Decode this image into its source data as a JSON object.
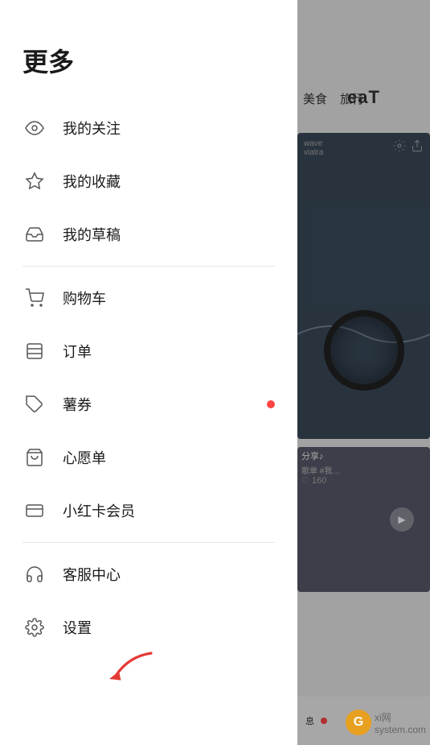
{
  "page": {
    "title": "更多",
    "background": {
      "tabs": [
        "美食",
        "旅行"
      ],
      "eat_text": "eaT",
      "card2_text": "分享♪",
      "card2_subtext": "歌单 #我…",
      "heart_count": "160",
      "bottom_label": "息"
    }
  },
  "menu": {
    "title": "更多",
    "items": [
      {
        "id": "my-follow",
        "label": "我的关注",
        "icon": "eye",
        "badge": false
      },
      {
        "id": "my-favorites",
        "label": "我的收藏",
        "icon": "star",
        "badge": false
      },
      {
        "id": "my-drafts",
        "label": "我的草稿",
        "icon": "inbox",
        "badge": false
      },
      {
        "id": "divider1",
        "type": "divider"
      },
      {
        "id": "shopping-cart",
        "label": "购物车",
        "icon": "cart",
        "badge": false
      },
      {
        "id": "orders",
        "label": "订单",
        "icon": "list",
        "badge": false
      },
      {
        "id": "coupons",
        "label": "薯券",
        "icon": "tag",
        "badge": true
      },
      {
        "id": "wishlist",
        "label": "心愿单",
        "icon": "bag",
        "badge": false
      },
      {
        "id": "vip",
        "label": "小红卡会员",
        "icon": "card",
        "badge": false
      },
      {
        "id": "divider2",
        "type": "divider"
      },
      {
        "id": "service",
        "label": "客服中心",
        "icon": "headset",
        "badge": false
      },
      {
        "id": "settings",
        "label": "设置",
        "icon": "gear",
        "badge": false
      }
    ]
  },
  "watermark": {
    "icon": "G",
    "text": "x i 网",
    "site": "system.com"
  }
}
